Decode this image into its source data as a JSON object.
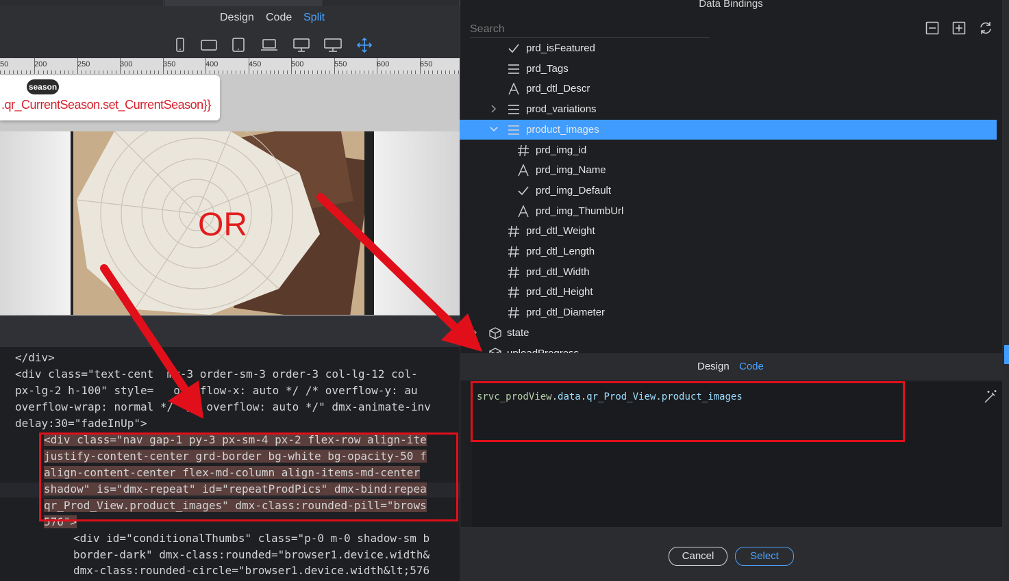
{
  "editor": {
    "view_modes": {
      "design": "Design",
      "code": "Code",
      "split": "Split"
    },
    "ruler_labels": [
      "50",
      "200",
      "250",
      "300",
      "350",
      "400",
      "450",
      "500",
      "550",
      "600",
      "650"
    ],
    "tooltip": {
      "badge": "season",
      "expression": ".qr_CurrentSeason.set_CurrentSeason}}"
    },
    "overlay_text": "OR",
    "code_lines": [
      "</div>",
      "<div class=\"text-cent  my-3 order-sm-3 order-3 col-lg-12 col-",
      "px-lg-2 h-100\" style=   overflow-x: auto */ /* overflow-y: au",
      "overflow-wrap: normal */  /* overflow: auto */\" dmx-animate-inv",
      "delay:30=\"fadeInUp\">",
      "<div class=\"nav gap-1 py-3 px-sm-4 px-2 flex-row align-ite",
      "justify-content-center grd-border bg-white bg-opacity-50 f",
      "align-content-center flex-md-column align-items-md-center",
      "shadow\" is=\"dmx-repeat\" id=\"repeatProdPics\" dmx-bind:repea",
      "qr_Prod_View.product_images\" dmx-class:rounded-pill=\"brows",
      "576\">",
      "<div id=\"conditionalThumbs\" class=\"p-0 m-0 shadow-sm b",
      "border-dark\" dmx-class:rounded=\"browser1.device.width&",
      "dmx-class:rounded-circle=\"browser1.device.width&lt;576"
    ]
  },
  "dialog": {
    "title": "Data Bindings",
    "search_placeholder": "Search",
    "tree": [
      {
        "label": "prd_isFeatured",
        "icon": "check-icon",
        "indent": 1
      },
      {
        "label": "prd_Tags",
        "icon": "list-icon",
        "indent": 1
      },
      {
        "label": "prd_dtl_Descr",
        "icon": "text-icon",
        "indent": 1
      },
      {
        "label": "prod_variations",
        "icon": "list-icon",
        "indent": 1,
        "expandable": "collapsed"
      },
      {
        "label": "product_images",
        "icon": "list-icon",
        "indent": 1,
        "expandable": "expanded",
        "selected": true
      },
      {
        "label": "prd_img_id",
        "icon": "number-icon",
        "indent": 2
      },
      {
        "label": "prd_img_Name",
        "icon": "text-icon",
        "indent": 2
      },
      {
        "label": "prd_img_Default",
        "icon": "check-icon",
        "indent": 2
      },
      {
        "label": "prd_img_ThumbUrl",
        "icon": "text-icon",
        "indent": 2
      },
      {
        "label": "prd_dtl_Weight",
        "icon": "number-icon",
        "indent": 1
      },
      {
        "label": "prd_dtl_Length",
        "icon": "number-icon",
        "indent": 1
      },
      {
        "label": "prd_dtl_Width",
        "icon": "number-icon",
        "indent": 1
      },
      {
        "label": "prd_dtl_Height",
        "icon": "number-icon",
        "indent": 1
      },
      {
        "label": "prd_dtl_Diameter",
        "icon": "number-icon",
        "indent": 1
      },
      {
        "label": "state",
        "icon": "cube-icon",
        "indent": 0,
        "expandable": "collapsed"
      },
      {
        "label": "uploadProgress",
        "icon": "cube-icon",
        "indent": 0
      }
    ],
    "mode_tabs": {
      "design": "Design",
      "code": "Code"
    },
    "expression": {
      "parts": [
        "srvc_prodView",
        ".",
        "data",
        ".",
        "qr_Prod_View",
        ".",
        "product_images"
      ]
    },
    "buttons": {
      "cancel": "Cancel",
      "select": "Select"
    },
    "colors": {
      "selection": "#409cff",
      "accent": "#4aa3ff",
      "annotation": "#e10f1a"
    }
  }
}
